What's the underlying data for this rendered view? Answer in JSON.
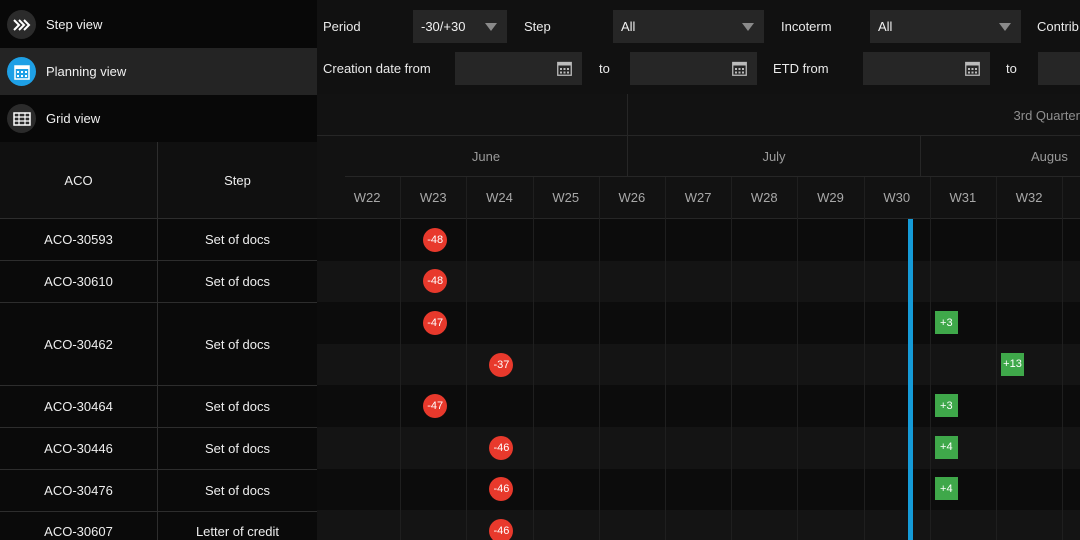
{
  "views": [
    {
      "label": "Step view",
      "icon": "step-chevrons-icon",
      "active": false
    },
    {
      "label": "Planning view",
      "icon": "calendar-icon",
      "active": true
    },
    {
      "label": "Grid view",
      "icon": "table-grid-icon",
      "active": false
    }
  ],
  "filters": {
    "period_label": "Period",
    "period_value": "-30/+30",
    "step_label": "Step",
    "step_value": "All",
    "incoterm_label": "Incoterm",
    "incoterm_value": "All",
    "contrib_label": "Contrib",
    "creation_from_label": "Creation date from",
    "to_label_1": "to",
    "etd_from_label": "ETD from",
    "to_label_2": "to"
  },
  "grid": {
    "aco_header": "ACO",
    "step_header": "Step",
    "rows": [
      {
        "aco": "ACO-30593",
        "step": "Set of docs"
      },
      {
        "aco": "ACO-30610",
        "step": "Set of docs"
      },
      {
        "aco": "ACO-30462",
        "step": "Set of docs"
      },
      {
        "aco": "ACO-30464",
        "step": "Set of docs"
      },
      {
        "aco": "ACO-30446",
        "step": "Set of docs"
      },
      {
        "aco": "ACO-30476",
        "step": "Set of docs"
      },
      {
        "aco": "ACO-30607",
        "step": "Letter of credit"
      }
    ]
  },
  "timeline": {
    "quarter_label": "3rd Quarter",
    "months": [
      "June",
      "July",
      "Augus"
    ],
    "weeks": [
      "W22",
      "W23",
      "W24",
      "W25",
      "W26",
      "W27",
      "W28",
      "W29",
      "W30",
      "W31",
      "W32"
    ],
    "current_week": "W30",
    "badges": [
      {
        "row": 0,
        "week": "W23",
        "value": "-48",
        "kind": "late"
      },
      {
        "row": 1,
        "week": "W23",
        "value": "-48",
        "kind": "late"
      },
      {
        "row": 2,
        "week": "W23",
        "value": "-47",
        "kind": "late"
      },
      {
        "row": 2,
        "week": "W31",
        "value": "+3",
        "kind": "early"
      },
      {
        "row": 3,
        "week": "W24",
        "value": "-37",
        "kind": "late"
      },
      {
        "row": 3,
        "week": "W32",
        "value": "+13",
        "kind": "early"
      },
      {
        "row": 4,
        "week": "W23",
        "value": "-47",
        "kind": "late"
      },
      {
        "row": 4,
        "week": "W31",
        "value": "+3",
        "kind": "early"
      },
      {
        "row": 5,
        "week": "W24",
        "value": "-46",
        "kind": "late"
      },
      {
        "row": 5,
        "week": "W31",
        "value": "+4",
        "kind": "early"
      },
      {
        "row": 6,
        "week": "W24",
        "value": "-46",
        "kind": "late"
      },
      {
        "row": 6,
        "week": "W31",
        "value": "+4",
        "kind": "early"
      },
      {
        "row": 7,
        "week": "W24",
        "value": "-46",
        "kind": "late"
      }
    ]
  },
  "colors": {
    "accent": "#1ea0e6",
    "late": "#e8392c",
    "early": "#3fa84a",
    "today_line": "#159bd8"
  }
}
